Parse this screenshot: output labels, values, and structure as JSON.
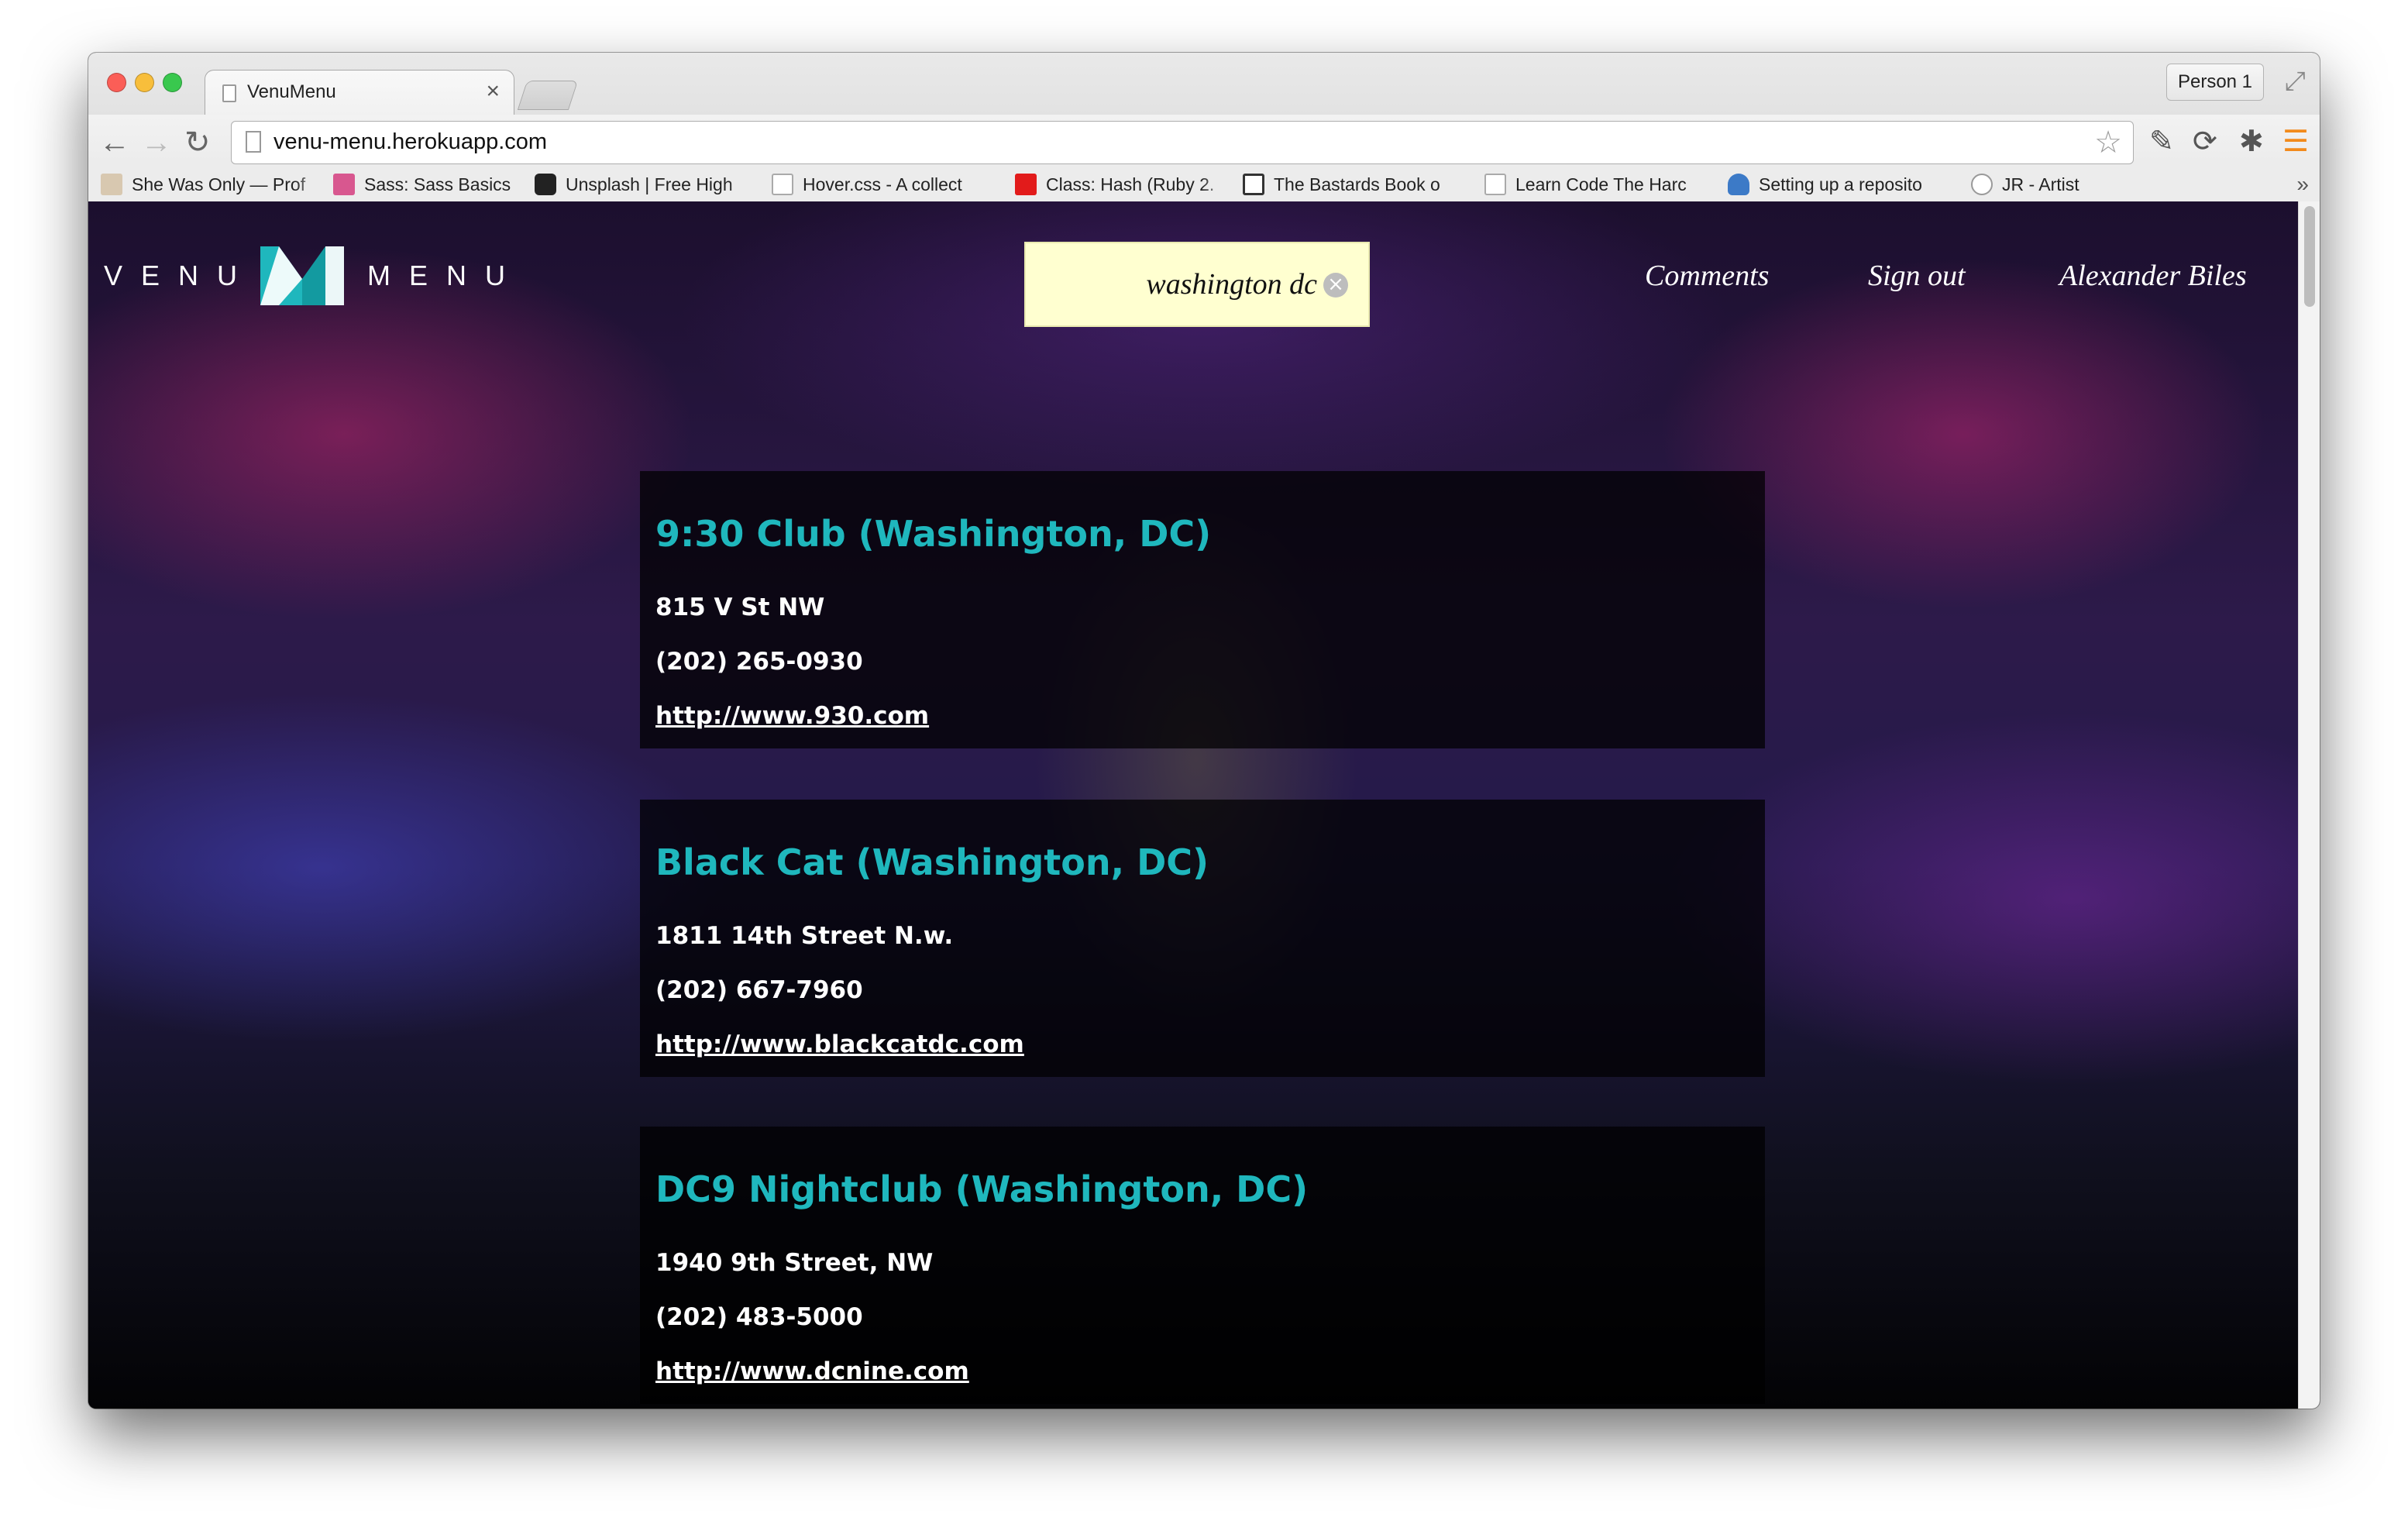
{
  "browser": {
    "tab_title": "VenuMenu",
    "tab_close": "×",
    "profile": "Person 1",
    "url": "venu-menu.herokuapp.com",
    "bookmarks": [
      {
        "label": "She Was Only — Prof",
        "icon": "image-favicon"
      },
      {
        "label": "Sass: Sass Basics",
        "icon": "sass-favicon"
      },
      {
        "label": "Unsplash | Free High",
        "icon": "camera-favicon"
      },
      {
        "label": "Hover.css - A collect",
        "icon": "page-favicon"
      },
      {
        "label": "Class: Hash (Ruby 2.",
        "icon": "ruby-favicon"
      },
      {
        "label": "The Bastards Book o",
        "icon": "book-favicon"
      },
      {
        "label": "Learn Code The Harc",
        "icon": "page-favicon"
      },
      {
        "label": "Setting up a reposito",
        "icon": "database-favicon"
      },
      {
        "label": "JR - Artist",
        "icon": "jr-favicon"
      }
    ],
    "bookmarks_more": "»"
  },
  "site": {
    "logo_left": "VENU",
    "logo_right": "MENU",
    "search_value": "washington dc",
    "search_clear": "×",
    "nav": {
      "comments": "Comments",
      "sign_out": "Sign out",
      "user": "Alexander Biles"
    }
  },
  "venues": [
    {
      "name": "9:30 Club (Washington, DC)",
      "address": "815 V St NW",
      "phone": "(202) 265-0930",
      "url": "http://www.930.com"
    },
    {
      "name": "Black Cat (Washington, DC)",
      "address": "1811 14th Street N.w.",
      "phone": "(202) 667-7960",
      "url": "http://www.blackcatdc.com"
    },
    {
      "name": "DC9 Nightclub (Washington, DC)",
      "address": "1940 9th Street, NW",
      "phone": "(202) 483-5000",
      "url": "http://www.dcnine.com"
    }
  ],
  "colors": {
    "accent": "#1fb7bd",
    "search_bg": "#ffffd0",
    "card_bg": "rgba(0,0,0,0.72)"
  }
}
